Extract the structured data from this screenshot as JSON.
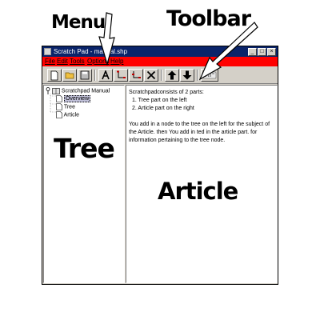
{
  "annotations": {
    "menu": "Menu",
    "toolbar": "Toolbar",
    "tree": "Tree",
    "article": "Article"
  },
  "window": {
    "title": "Scratch Pad - manual.shp",
    "menubar_color": "#ff0000",
    "menu": [
      "File",
      "Edit",
      "Tools",
      "Options",
      "Help"
    ],
    "buttons": {
      "minimize": "_",
      "maximize": "□",
      "close": "×"
    }
  },
  "toolbar": {
    "buttons": [
      "new-icon",
      "open-icon",
      "save-icon",
      "font-icon",
      "add-child-node-icon",
      "add-sibling-node-icon",
      "delete-icon",
      "move-up-icon",
      "move-down-icon",
      "about-icon"
    ]
  },
  "tree": {
    "root": "Scratchpad Manual",
    "children": [
      "Overview",
      "Tree",
      "Article"
    ],
    "selected": "Overview"
  },
  "article": {
    "intro": "Scratchpadconsists of 2 parts:",
    "items": [
      "1.  Tree part on the left",
      "2.  Article part on the right"
    ],
    "body": "You add in a node to the tree on the left for the subject of the Article. then You add in ted in the article part. for information pertaining to the tree node."
  }
}
